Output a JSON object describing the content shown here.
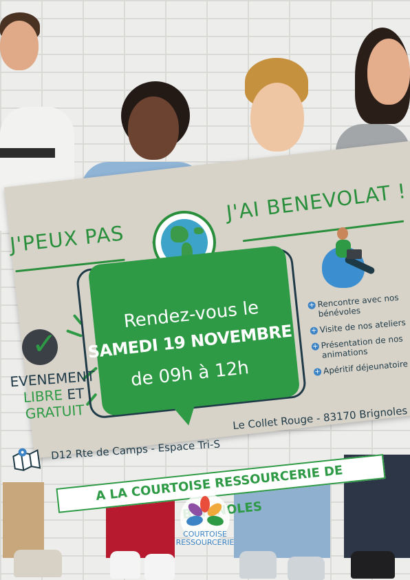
{
  "headline": {
    "left": "J'PEUX PAS",
    "right": "J'AI BENEVOLAT !"
  },
  "bubble": {
    "line1": "Rendez-vous le",
    "line2": "SAMEDI 19 NOVEMBRE",
    "line3": "de 09h à 12h"
  },
  "event": {
    "line1": "EVENEMENT",
    "word_libre": "LIBRE",
    "word_et": "ET",
    "line3": "GRATUIT"
  },
  "activities": [
    "Rencontre avec nos bénévoles",
    "Visite de nos ateliers",
    "Présentation de nos animations",
    "Apéritif déjeunatoire"
  ],
  "address": {
    "left": "D12 Rte de Camps - Espace Tri-S",
    "right": "Le Collet Rouge - 83170 Brignoles"
  },
  "organisation": "A LA COURTOISE RESSOURCERIE DE BRIGNOLES",
  "logo": {
    "line1": "COURTOISE",
    "line2": "RESSOURCERIE"
  },
  "colors": {
    "green": "#2e9a45",
    "navy": "#1f3a47",
    "blue": "#3b83c4",
    "banner": "#d8d3c9"
  },
  "icons": [
    "globe-icon",
    "heart-icon",
    "checkmark-icon",
    "plus-icon",
    "map-pin-icon",
    "laptop-person-illustration"
  ]
}
